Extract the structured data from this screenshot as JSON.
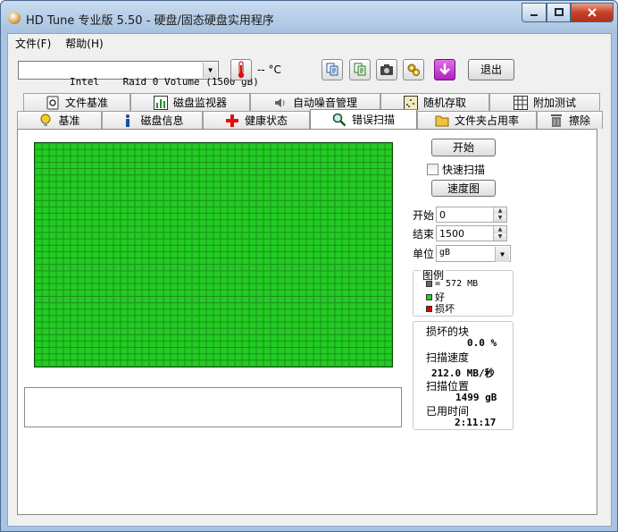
{
  "window": {
    "title": "HD Tune 专业版 5.50 - 硬盘/固态硬盘实用程序"
  },
  "menu": {
    "file": "文件(F)",
    "help": "帮助(H)"
  },
  "toolbar": {
    "drive": "Intel    Raid 0 Volume (1500 gB)",
    "temperature": "-- °C",
    "exit_label": "退出",
    "icons": [
      "copy-icon",
      "copy-all-icon",
      "camera-icon",
      "settings-icon",
      "download-icon"
    ]
  },
  "tabs_top": [
    "文件基准",
    "磁盘监视器",
    "自动噪音管理",
    "随机存取",
    "附加测试"
  ],
  "tabs_bottom": [
    "基准",
    "磁盘信息",
    "健康状态",
    "错误扫描",
    "文件夹占用率",
    "擦除"
  ],
  "active_tab": "错误扫描",
  "scan": {
    "start_button": "开始",
    "quick_scan_label": "快速扫描",
    "speed_map_button": "速度图",
    "start_label": "开始",
    "start_value": "0",
    "end_label": "结束",
    "end_value": "1500",
    "unit_label": "单位",
    "unit_value": "gB",
    "grid_cols": 50,
    "grid_rows": 35,
    "block_status": "ok"
  },
  "legend": {
    "title": "图例",
    "block_size": "= 572 MB",
    "good": "好",
    "damaged": "损坏",
    "colors": {
      "block": "#666666",
      "good": "#22cc22",
      "damaged": "#dd0000"
    }
  },
  "stats": {
    "damaged_label": "损坏的块",
    "damaged_value": "0.0 %",
    "speed_label": "扫描速度",
    "speed_value": "212.0 MB/秒",
    "position_label": "扫描位置",
    "position_value": "1499 gB",
    "elapsed_label": "已用时间",
    "elapsed_value": "2:11:17"
  }
}
